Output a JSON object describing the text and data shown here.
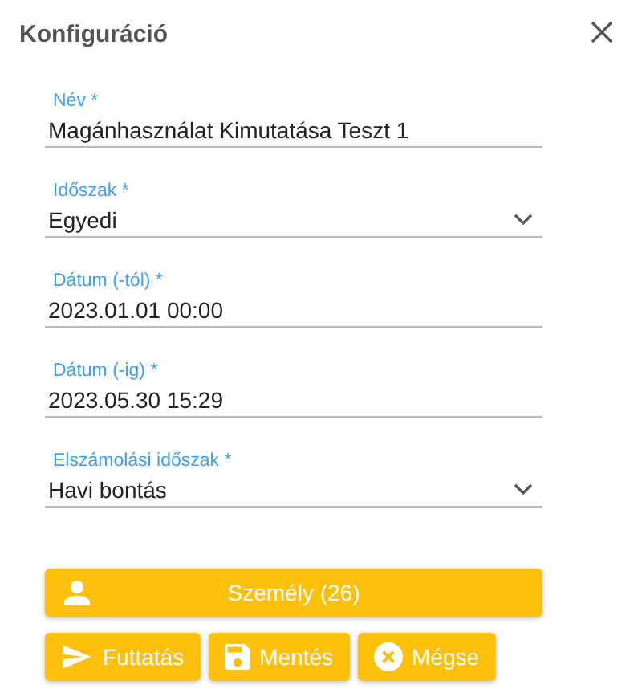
{
  "dialog": {
    "title": "Konfiguráció"
  },
  "fields": [
    {
      "kind": "text",
      "label": "Név *",
      "value": "Magánhasználat Kimutatása Teszt 1"
    },
    {
      "kind": "select",
      "label": "Időszak *",
      "value": "Egyedi"
    },
    {
      "kind": "text",
      "label": "Dátum (-tól) *",
      "value": "2023.01.01 00:00"
    },
    {
      "kind": "text",
      "label": "Dátum (-ig) *",
      "value": "2023.05.30 15:29"
    },
    {
      "kind": "select",
      "label": "Elszámolási időszak *",
      "value": "Havi bontás"
    }
  ],
  "person_button": {
    "label": "Személy (26)"
  },
  "actions": [
    {
      "kind": "run",
      "label": "Futtatás"
    },
    {
      "kind": "save",
      "label": "Mentés"
    },
    {
      "kind": "cancel",
      "label": "Mégse"
    }
  ]
}
